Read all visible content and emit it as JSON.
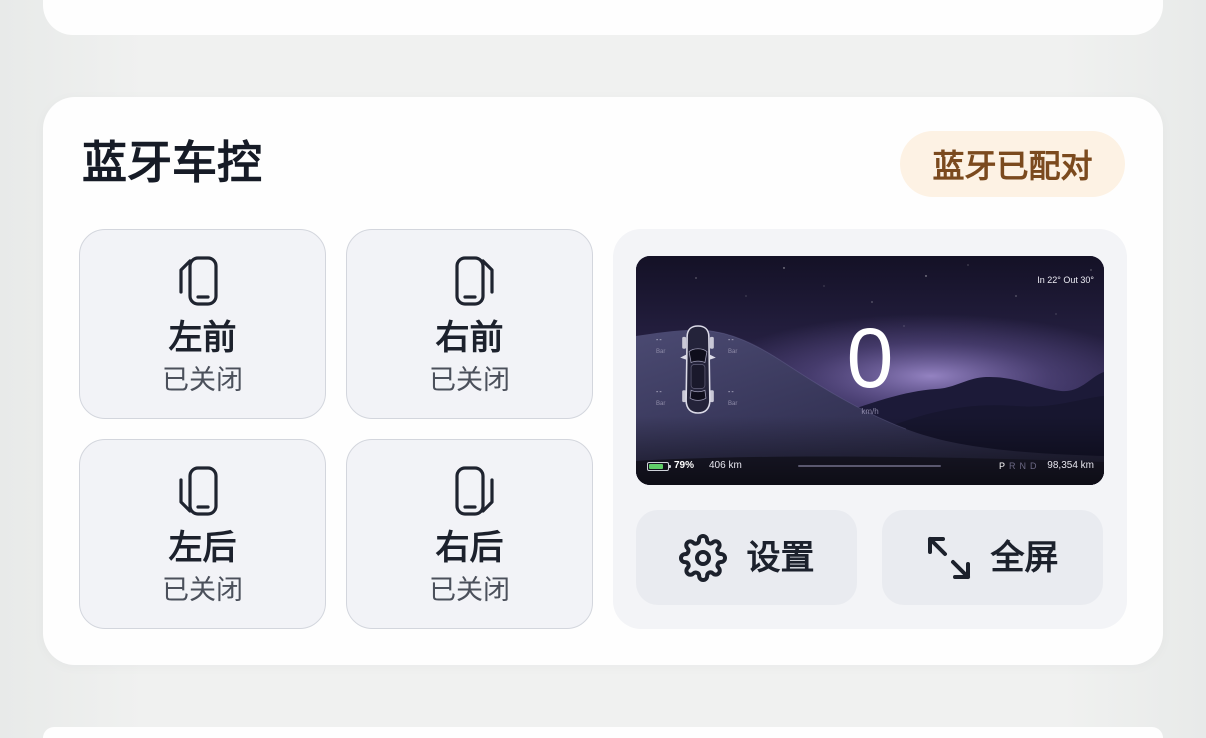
{
  "page": {
    "background": "#eef0ef"
  },
  "card": {
    "title": "蓝牙车控",
    "badge": {
      "label": "蓝牙已配对",
      "bg_color": "#fdf2e4",
      "text_color": "#7b4a1e"
    }
  },
  "doors": [
    {
      "label": "左前",
      "status": "已关闭",
      "icon": "door-front-left-icon"
    },
    {
      "label": "右前",
      "status": "已关闭",
      "icon": "door-front-right-icon"
    },
    {
      "label": "左后",
      "status": "已关闭",
      "icon": "door-rear-left-icon"
    },
    {
      "label": "右后",
      "status": "已关闭",
      "icon": "door-rear-right-icon"
    }
  ],
  "dashboard": {
    "temperature": "In 22° Out 30°",
    "speed": "0",
    "speed_unit": "km/h",
    "tires": [
      {
        "value": "--",
        "unit": "Bar"
      },
      {
        "value": "--",
        "unit": "Bar"
      },
      {
        "value": "--",
        "unit": "Bar"
      },
      {
        "value": "--",
        "unit": "Bar"
      }
    ],
    "battery": {
      "percent_label": "79%",
      "level": 0.79,
      "color": "#5fcf68"
    },
    "range": "406 km",
    "gears": [
      {
        "label": "P",
        "active": true
      },
      {
        "label": "R",
        "active": false
      },
      {
        "label": "N",
        "active": false
      },
      {
        "label": "D",
        "active": false
      }
    ],
    "odometer": "98,354 km"
  },
  "actions": [
    {
      "label": "设置",
      "icon": "gear-icon"
    },
    {
      "label": "全屏",
      "icon": "expand-icon"
    }
  ]
}
